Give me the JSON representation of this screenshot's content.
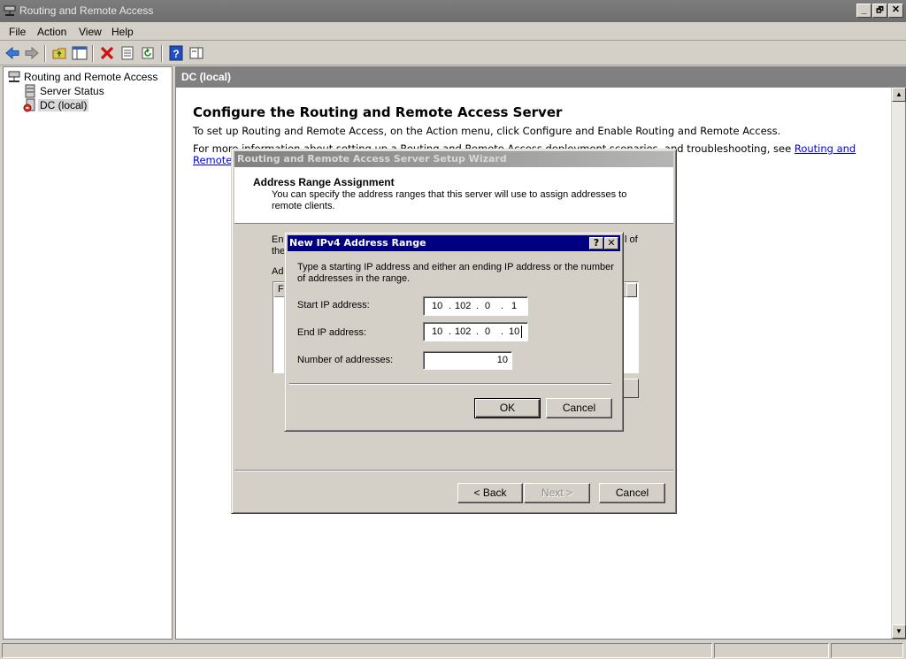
{
  "window": {
    "title": "Routing and Remote Access",
    "controls": [
      "_",
      "🗗",
      "✕"
    ]
  },
  "menu": [
    "File",
    "Action",
    "View",
    "Help"
  ],
  "tree": {
    "root": "Routing and Remote Access",
    "items": [
      "Server Status",
      "DC (local)"
    ]
  },
  "right_pane": {
    "header": "DC (local)",
    "title": "Configure the Routing and Remote Access Server",
    "line1": "To set up Routing and Remote Access, on the Action menu, click Configure and Enable Routing and Remote Access.",
    "line2_start": "For more information about setting up a Routing and Remote Access deployment scenarios, and troubleshooting, see ",
    "link_part1": "Routing and",
    "link_part2": "Remote"
  },
  "wizard": {
    "title": "Routing and Remote Access Server Setup Wizard",
    "heading": "Address Range Assignment",
    "subheading": "You can specify the address ranges that this server will use to assign addresses to remote clients.",
    "frag_ent": "Ent",
    "frag_the": "the",
    "frag_of": "l of",
    "frag_ad": "Ad",
    "list_col_frag": "F",
    "back_label": "< Back",
    "next_label": "Next >",
    "cancel_label": "Cancel"
  },
  "dialog": {
    "title": "New IPv4 Address Range",
    "help_btn": "?",
    "close_btn": "✕",
    "instructions": "Type a starting IP address and either an ending IP address or the number of addresses in the range.",
    "start_label": "Start IP address:",
    "start_ip": [
      "10",
      "102",
      "0",
      "1"
    ],
    "end_label": "End IP address:",
    "end_ip": [
      "10",
      "102",
      "0",
      "10"
    ],
    "count_label": "Number of addresses:",
    "count_value": "10",
    "ok_label": "OK",
    "cancel_label": "Cancel"
  },
  "colors": {
    "dialog_titlebar": "#000080",
    "window_titlebar": "#707070",
    "link": "#0000ee"
  }
}
